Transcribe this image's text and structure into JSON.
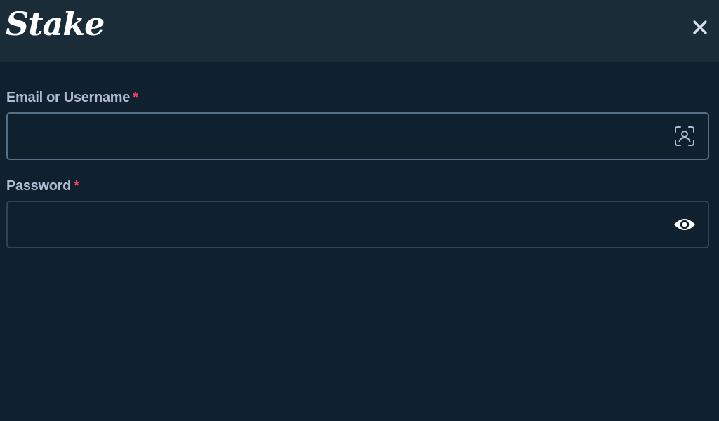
{
  "header": {
    "logo_text": "Stake"
  },
  "form": {
    "email": {
      "label": "Email or Username",
      "required_mark": "*",
      "value": "",
      "placeholder": "",
      "icon": "user-scan-icon"
    },
    "password": {
      "label": "Password",
      "required_mark": "*",
      "value": "",
      "placeholder": "",
      "icon": "eye-icon"
    }
  },
  "colors": {
    "background": "#0f212e",
    "header": "#1a2c38",
    "label": "#b1bad3",
    "required": "#ed4163",
    "input_border": "#2f4553"
  }
}
